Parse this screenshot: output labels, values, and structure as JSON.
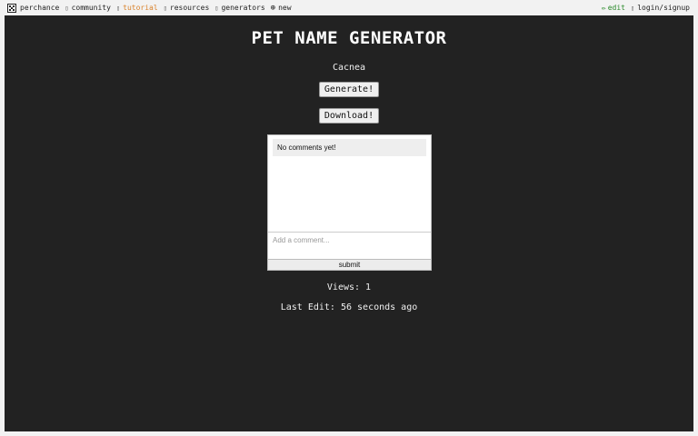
{
  "nav": {
    "logo_label": "perchance",
    "community": "community",
    "tutorial": "tutorial",
    "resources": "resources",
    "generators": "generators",
    "new": "new",
    "edit": "edit",
    "login": "login/signup",
    "tutorial_color": "#d9822b",
    "edit_color": "#2a8a2a"
  },
  "main": {
    "title": "PET NAME GENERATOR",
    "result": "Cacnea",
    "generate_label": "Generate!",
    "download_label": "Download!",
    "background": "#222222"
  },
  "comments": {
    "empty_text": "No comments yet!",
    "placeholder": "Add a comment...",
    "submit_label": "submit"
  },
  "stats": {
    "views": "Views: 1",
    "last_edit": "Last Edit: 56 seconds ago"
  }
}
